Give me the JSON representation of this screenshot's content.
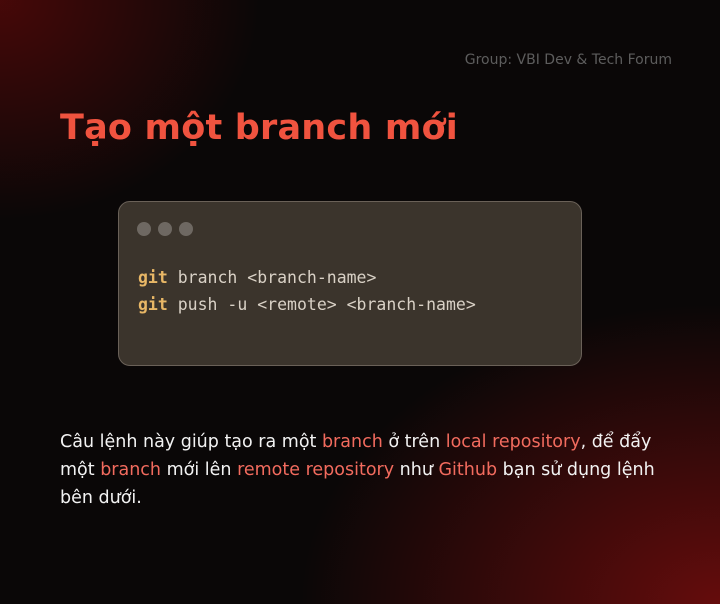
{
  "header": {
    "group": "Group: VBI Dev & Tech Forum"
  },
  "title": "Tạo một branch mới",
  "code_window": {
    "lines": [
      {
        "cmd": "git",
        "rest": " branch <branch-name>"
      },
      {
        "cmd": "git",
        "rest": " push -u <remote> <branch-name>"
      }
    ]
  },
  "description": {
    "p1": "Câu lệnh này giúp tạo ra một ",
    "h1": "branch",
    "p2": " ở trên ",
    "h2": "local repository",
    "p3": ", để đẩy một ",
    "h3": "branch",
    "p4": " mới lên ",
    "h4": "remote repository",
    "p5": " như ",
    "h5": "Github",
    "p6": " bạn sử dụng lệnh bên dưới."
  },
  "colors": {
    "accent": "#f0533f",
    "highlight": "#f26b5e",
    "code_keyword": "#e8b766",
    "code_bg": "#3b342c",
    "background": "#0a0707"
  }
}
